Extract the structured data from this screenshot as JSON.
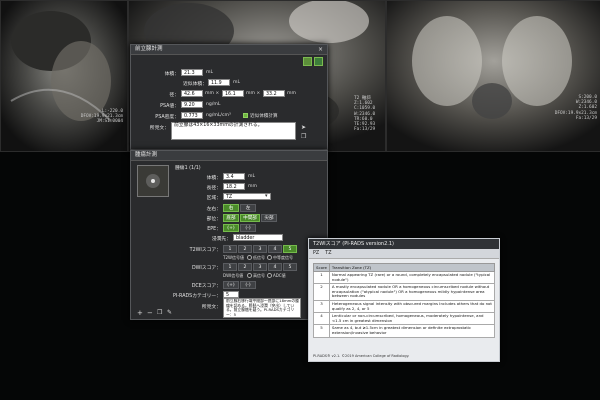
{
  "mri_left": {
    "lines": [
      "L:-220.0",
      "DFOV:19.9x21.3cm",
      "JM:S1:0004"
    ]
  },
  "mri_center": {
    "left_lines": [
      "DFOV:19.9x21.3cm",
      "JM:S0:4/S6"
    ],
    "right_lines": [
      "T2 軸斜",
      "Z:1.602",
      "C:1059.0",
      "W:2346.0",
      "TR:60.0",
      "TE:92.93",
      "Fa:13/29"
    ]
  },
  "mri_right": {
    "lines": [
      "S:200.0",
      "W:2346.0",
      "Z:1.602",
      "DFOV:19.9x21.3cm",
      "Fa:13/29"
    ]
  },
  "panel_title": "前立腺計測",
  "volume": {
    "volume_label": "体積：",
    "volume_value": "21.3",
    "volume_unit": "mL",
    "approx_label": "近似体積：",
    "approx_value": "11.9",
    "approx_unit": "mL",
    "diam_label": "径：",
    "diam1": "42.6",
    "diam2": "16.1",
    "diam3": "33.2",
    "mmx1": "mm ×",
    "mmx2": "mm ×",
    "mm_end": "mm",
    "psa_label": "PSA値：",
    "psa_value": "9.20",
    "psa_unit": "ng/mL",
    "psad_label": "PSA密度：",
    "psad_value": "0.773",
    "psad_unit": "ng/mL/cm³",
    "approx_calc_label": "近似体積計算",
    "finding_label": "所見文：",
    "finding_text": "前立腺は43×16×33mmの計測される。"
  },
  "lesion": {
    "section_title": "腫瘍計測",
    "lesion_name": "腫瘍1 (1/1)",
    "vol_label": "体積：",
    "vol_value": "3.4",
    "vol_unit": "mL",
    "major_label": "長径：",
    "major_value": "18.2",
    "major_unit": "mm",
    "zone_label": "区域：",
    "zone_value": "TZ",
    "lr_label": "左右：",
    "lr_options": [
      "右",
      "左"
    ],
    "loc_label": "部位：",
    "loc_options": [
      "底部",
      "中間部",
      "尖部"
    ],
    "epe_label": "EPE：",
    "epe_options": [
      "(+)",
      "(-)"
    ],
    "invade_label": "浸潤先：",
    "invade_value": "bladder",
    "t2_label": "T2WIスコア：",
    "t2_scores": [
      "1",
      "2",
      "3",
      "4",
      "5"
    ],
    "t2_opts": [
      "T2W信号値",
      "低信号",
      "中等度信号"
    ],
    "dwi_label": "DWIスコア：",
    "dwi_scores": [
      "1",
      "2",
      "3",
      "4",
      "5"
    ],
    "dwi_opts": [
      "DWI信号値",
      "高信号",
      "ADC値"
    ],
    "dce_label": "DCEスコア：",
    "dce_options": [
      "(+)",
      "(-)"
    ],
    "pirads_label": "PI-RADSカテゴリー：",
    "pirads_value": "5",
    "finding_label": "所見文：",
    "finding_text": "前立腺右移行域中間部～底部に18mmの腫瘤を認める。膀胱へ浸潤（突出）している。前立腺癌を疑う。PI-RADSカテゴリー：5"
  },
  "popup": {
    "title": "T2WIスコア (PI-RADS version2.1)",
    "tabs": [
      "PZ",
      "TZ"
    ],
    "headers": [
      "Score",
      "Transition Zone (TZ)"
    ],
    "rows": [
      {
        "score": "1",
        "text": "Normal appearing TZ (rare) or a round, completely encapsulated nodule (\"typical nodule\")"
      },
      {
        "score": "2",
        "text": "A mostly encapsulated nodule OR a homogeneous circumscribed nodule without encapsulation (\"atypical nodule\") OR a homogeneous mildly hypointense area between nodules"
      },
      {
        "score": "3",
        "text": "Heterogeneous signal intensity with obscured margins Includes others that do not qualify as 2, 4, or 5"
      },
      {
        "score": "4",
        "text": "Lenticular or non-circumscribed, homogeneous, moderately hypointense, and <1.5 cm in greatest dimension"
      },
      {
        "score": "5",
        "text": "Same as 4, but ≥1.5cm in greatest dimension or definite extraprostatic extension/invasive behavior"
      }
    ],
    "footer": "PI-RADS® v2.1. ©2019 American College of Radiology."
  },
  "colors": {
    "accent_green": "#4a8a2a",
    "panel_bg": "#2a2b2d",
    "popup_bg": "#e9ebee"
  }
}
